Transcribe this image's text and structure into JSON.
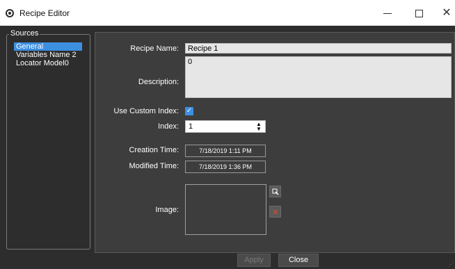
{
  "window": {
    "title": "Recipe Editor",
    "controls": {
      "minimize": "–",
      "maximize": "☐",
      "close": "✕"
    }
  },
  "sources": {
    "legend": "Sources",
    "items": [
      {
        "label": "General",
        "selected": true
      },
      {
        "label": "Variables Name 2",
        "selected": false
      },
      {
        "label": "Locator Model0",
        "selected": false
      }
    ]
  },
  "form": {
    "recipe_name": {
      "label": "Recipe Name:",
      "value": "Recipe 1"
    },
    "description": {
      "label": "Description:",
      "value": "0"
    },
    "use_custom_index": {
      "label": "Use Custom Index:",
      "checked": true,
      "glyph": "✓"
    },
    "index": {
      "label": "Index:",
      "value": "1",
      "arrows": "▲▼"
    },
    "creation_time": {
      "label": "Creation Time:",
      "value": "7/18/2019 1:11 PM"
    },
    "modified_time": {
      "label": "Modified Time:",
      "value": "7/18/2019 1:36 PM"
    },
    "image": {
      "label": "Image:",
      "browse_icon": "browse-image-icon",
      "clear_icon": "clear-image-icon"
    }
  },
  "buttons": {
    "apply": "Apply",
    "close": "Close"
  },
  "colors": {
    "accent": "#3d8fe0",
    "background": "#2d2d2d",
    "panel": "#3d3d3d"
  }
}
